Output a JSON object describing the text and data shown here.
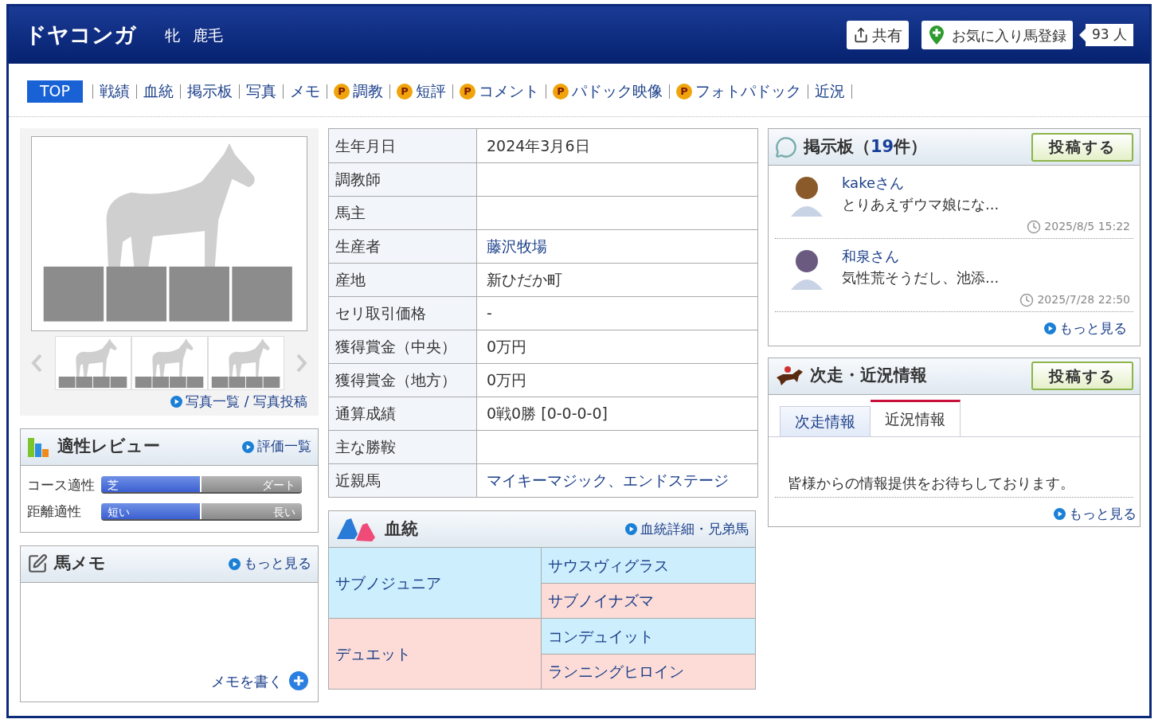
{
  "header": {
    "name": "ドヤコンガ",
    "sex": "牝",
    "coat": "鹿毛",
    "share": "共有",
    "favorite": "お気に入り馬登録",
    "fans": "93 人"
  },
  "nav": [
    {
      "label": "TOP",
      "selected": true
    },
    {
      "label": "戦績",
      "selected": false
    },
    {
      "label": "血統",
      "selected": false
    },
    {
      "label": "掲示板",
      "selected": false
    },
    {
      "label": "写真",
      "selected": false
    },
    {
      "label": "メモ",
      "selected": false
    },
    {
      "label": "調教",
      "selected": false,
      "badge": "P"
    },
    {
      "label": "短評",
      "selected": false,
      "badge": "P"
    },
    {
      "label": "コメント",
      "selected": false,
      "badge": "P"
    },
    {
      "label": "パドック映像",
      "selected": false,
      "badge": "P"
    },
    {
      "label": "フォトパドック",
      "selected": false,
      "badge": "P"
    },
    {
      "label": "近況",
      "selected": false
    }
  ],
  "photos": {
    "links": "写真一覧 / 写真投稿"
  },
  "aptitude": {
    "title": "適性レビュー",
    "link": "評価一覧",
    "rows": [
      {
        "label": "コース適性",
        "left": "芝",
        "right": "ダート",
        "level": 0.5
      },
      {
        "label": "距離適性",
        "left": "短い",
        "right": "長い",
        "level": 0.5
      }
    ]
  },
  "memo": {
    "title": "馬メモ",
    "link": "もっと見る",
    "write": "メモを書く"
  },
  "profile": [
    {
      "label": "生年月日",
      "value": "2024年3月6日",
      "link": false
    },
    {
      "label": "調教師"
    },
    {
      "label": "馬主"
    },
    {
      "label": "生産者",
      "value": "藤沢牧場",
      "link": true
    },
    {
      "label": "産地",
      "value": "新ひだか町",
      "link": false
    },
    {
      "label": "セリ取引価格",
      "value": "-",
      "link": false
    },
    {
      "label": "獲得賞金（中央）",
      "value": "0万円",
      "link": false
    },
    {
      "label": "獲得賞金（地方）",
      "value": "0万円",
      "link": false
    },
    {
      "label": "通算成績",
      "value": "0戦0勝 [0-0-0-0]",
      "link": false
    },
    {
      "label": "主な勝鞍"
    },
    {
      "label": "近親馬",
      "value": "マイキーマジック、エンドステージ",
      "link": true
    }
  ],
  "pedigree": {
    "title": "血統",
    "link": "血統詳細・兄弟馬",
    "parents": [
      {
        "name": "サブノジュニア",
        "color": "#cdeefd",
        "children": [
          {
            "name": "サウスヴィグラス",
            "color": "#cdeefd"
          },
          {
            "name": "サブノイナズマ",
            "color": "#fddcd7"
          }
        ]
      },
      {
        "name": "デュエット",
        "color": "#fddcd7",
        "children": [
          {
            "name": "コンデュイット",
            "color": "#cdeefd"
          },
          {
            "name": "ランニングヒロイン",
            "color": "#fddcd7"
          }
        ]
      }
    ]
  },
  "board": {
    "title": "掲示板（**19**件）",
    "post": "投稿する",
    "more": "もっと見る",
    "posts": [
      {
        "user": "kakeさん",
        "text": "とりあえずウマ娘にな...",
        "time": "2025/8/5 15:22"
      },
      {
        "user": "和泉さん",
        "text": "気性荒そうだし、池添...",
        "time": "2025/7/28 22:50"
      }
    ]
  },
  "news": {
    "title": "次走・近況情報",
    "post": "投稿する",
    "tabs": [
      {
        "label": "次走情報",
        "selected": false
      },
      {
        "label": "近況情報",
        "selected": true
      }
    ],
    "message": "皆様からの情報提供をお待ちしております。",
    "more": "もっと見る"
  }
}
